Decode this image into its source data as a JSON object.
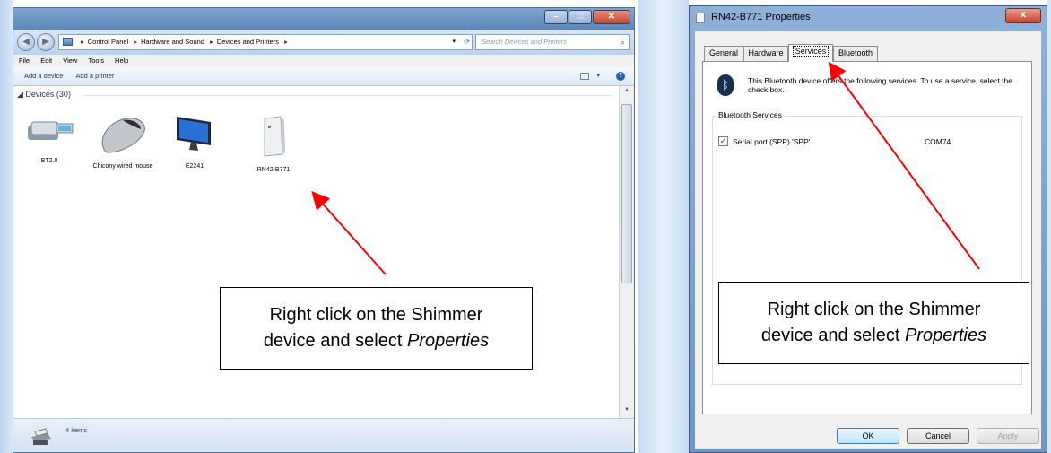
{
  "explorer": {
    "breadcrumb": [
      "Control Panel",
      "Hardware and Sound",
      "Devices and Printers"
    ],
    "search_placeholder": "Search Devices and Printers",
    "menu": [
      "File",
      "Edit",
      "View",
      "Tools",
      "Help"
    ],
    "commands": [
      "Add a device",
      "Add a printer"
    ],
    "group_header": "Devices (30)",
    "devices": [
      {
        "label": "BT2.0",
        "icon": "usb-dongle-icon"
      },
      {
        "label": "Chicony wired mouse",
        "icon": "mouse-icon"
      },
      {
        "label": "E2241",
        "icon": "monitor-icon"
      },
      {
        "label": "RN42-B771",
        "icon": "device-tower-icon"
      }
    ],
    "status": "4 items"
  },
  "props": {
    "title": "RN42-B771 Properties",
    "tabs": [
      "General",
      "Hardware",
      "Services",
      "Bluetooth"
    ],
    "active_tab": "Services",
    "intro": "This Bluetooth device offers the following services. To use a service, select the check box.",
    "group_label": "Bluetooth Services",
    "services": [
      {
        "name": "Serial port (SPP) 'SPP'",
        "port": "COM74",
        "checked": true
      }
    ],
    "buttons": {
      "ok": "OK",
      "cancel": "Cancel",
      "apply": "Apply"
    }
  },
  "callouts": {
    "left": {
      "line1": "Right click on the Shimmer",
      "line2": "device and select ",
      "emph": "Properties"
    },
    "right": {
      "line1": "Right click on the Shimmer",
      "line2": "device and select ",
      "emph": "Properties"
    }
  },
  "colors": {
    "arrow": "#ff0000",
    "accent": "#2563b5"
  }
}
